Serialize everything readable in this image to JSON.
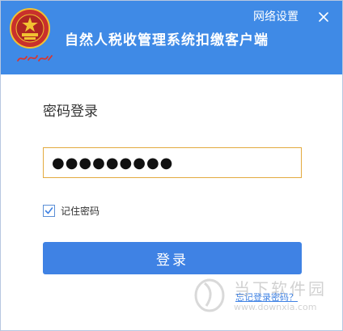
{
  "header": {
    "app_title": "自然人税收管理系统扣缴客户端",
    "network_settings": "网络设置",
    "emblem_caption": "中国税务",
    "close_icon": "close-icon",
    "accent_color": "#3f8ae6"
  },
  "login": {
    "section_title": "密码登录",
    "password_masked": "●●●●●●●●●",
    "remember": {
      "label": "记住密码",
      "checked": true
    },
    "submit_label": "登录",
    "forgot_label": "忘记登录密码？",
    "button_color": "#3f82e4",
    "input_border_color": "#e3aa3f"
  },
  "watermark": {
    "brand": "当下软件园",
    "site": "www.downxia.com"
  }
}
